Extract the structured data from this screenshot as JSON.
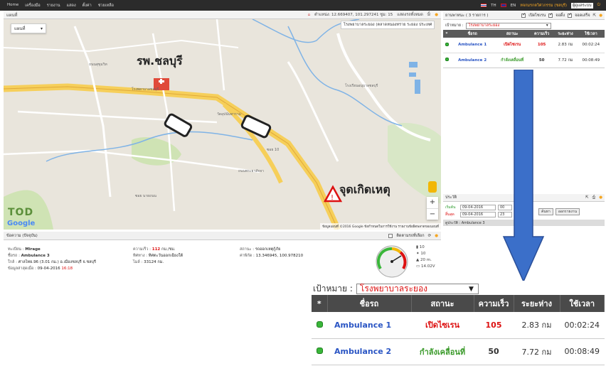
{
  "topbar": {
    "nav": [
      "Home",
      "เครื่องมือ",
      "รายงาน",
      "แสดง",
      "ตั้งค่า",
      "ช่วยเหลือ"
    ],
    "lang_th": "TH",
    "lang_en": "EN",
    "company": "หจกมรกตวิศวกรรม (ชลบุรี)",
    "user_label": "ผู้ดูแลระบบ"
  },
  "map": {
    "header_title": "แผนที่",
    "coords": "ตำแหน่ง: 12.669407, 101.297241 ซูม: 15",
    "show_all": "แสดงรถทั้งหมด",
    "maptype": "แผนที่",
    "address_bar": "โรงพยาบาลระยอง (ตลาดหนองทราย ระยอง ประเทศ",
    "hospital_label": "รพ.ชลบุรี",
    "incident_label": "จุดเกิดเหตุ",
    "zoom_in": "+",
    "zoom_out": "−",
    "brand": "TOD",
    "google": "Google",
    "attribution": "ข้อมูลแผนที่ ©2016 Google   ข้อกำหนดในการใช้งาน   รายงานข้อผิดพลาดของแผนที่"
  },
  "detail": {
    "header_title": "ข้อความ (ปัจจุบัน)",
    "follow_label": "ติดตามรถที่เลือก",
    "registration_label": "ทะเบียน :",
    "registration_value": "Mirage",
    "vehicle_label": "ชื่อรถ :",
    "vehicle_value": "Ambulance 3",
    "location_label": "ใกล้ :",
    "location_value": "ศาลไทย.96 (3.01 กม.) อ.เมืองชลบุรี จ.ชลบุรี",
    "lastdata_label": "ข้อมูลล่าสุดเมื่อ :",
    "lastdata_date": "09-04-2016",
    "lastdata_time": "16:18",
    "speed_label": "ความเร็ว :",
    "speed_value": "112",
    "speed_unit": "กม./ชม.",
    "direction_label": "ทิศทาง :",
    "direction_value": "ทิศตะวันออกเฉียงใต้",
    "mileage_label": "ไมล์ :",
    "mileage_value": "33124 กม.",
    "status_label": "สถานะ :",
    "status_value": "รถออกเหตุกู้ภัย",
    "latlng_label": "ค่าพิกัด :",
    "latlng_value": "13.346945, 100.978210",
    "side_values": [
      "10",
      "10",
      "20 m.",
      "14.02V"
    ]
  },
  "right_panel": {
    "header_title": "ยานพาหนะ ( 3 รายการ )",
    "check_labels": [
      "เปิดไซเรน",
      "จอดิ้ง",
      "จอดเสร็จ"
    ],
    "target_label": "เป้าหมาย :",
    "target_value": "โรงพยาบาลระยอง",
    "columns": [
      "*",
      "ชื่อรถ",
      "สถานะ",
      "ความเร็ว",
      "ระยะห่าง",
      "ใช้เวลา"
    ],
    "rows": [
      {
        "name": "Ambulance 1",
        "status": "เปิดไซเรน",
        "status_color": "#d11111",
        "speed": "105",
        "distance": "2.83 กม",
        "time": "00:02:24"
      },
      {
        "name": "Ambulance 2",
        "status": "กำลังเคลื่อนที่",
        "status_color": "#3a9a2a",
        "speed": "50",
        "distance": "7.72 กม",
        "time": "00:08:49"
      }
    ]
  },
  "history": {
    "header_title": "ประวัติ",
    "from_label": "เริ่มต้น",
    "from_date": "09-04-2016",
    "from_h": "00",
    "from_m": "00",
    "to_label": "สิ้นสุด",
    "to_date": "09-04-2016",
    "to_h": "23",
    "to_m": "59",
    "search_button": "ค้นหา",
    "export_button": "ออกรายงาน",
    "result_bar": "ดูประวัติ : Ambulance 3"
  },
  "inset": {
    "target_label": "เป้าหมาย :",
    "target_value": "โรงพยาบาลระยอง",
    "columns": [
      "*",
      "ชื่อรถ",
      "สถานะ",
      "ความเร็ว",
      "ระยะห่าง",
      "ใช้เวลา"
    ]
  },
  "colors": {
    "accent_red": "#d11111",
    "accent_green": "#3a9a2a",
    "ambulance_blue": "#2a55c4",
    "arrow_blue": "#3b6fc9"
  }
}
